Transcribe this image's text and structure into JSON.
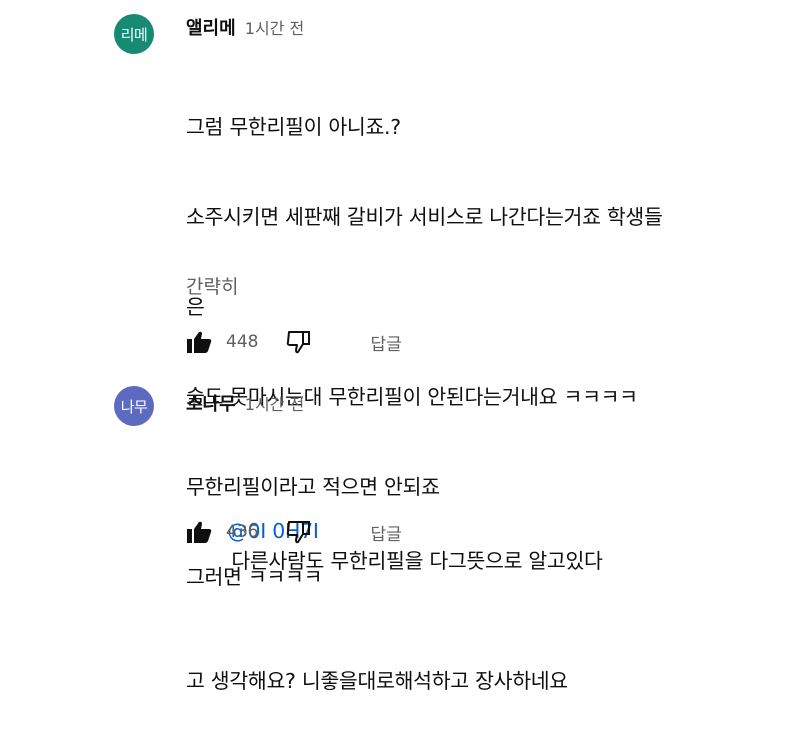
{
  "colors": {
    "avatar1": "#168a73",
    "avatar2": "#5c6bc0",
    "link": "#065fd4",
    "muted": "#606060"
  },
  "comments": [
    {
      "avatar_text": "리메",
      "author": "앨리메",
      "time": "1시간 전",
      "lines": [
        "그럼 무한리필이 아니죠.?",
        "소주시키면 세판째 갈비가 서비스로 나간다는거죠 학생들",
        "은",
        "술도 못마시는대 무한리필이 안된다는거내요 ㅋㅋㅋㅋ",
        "무한리필이라고 적으면 안되죠",
        "그러면 ㅋㅋㅋㅋ"
      ],
      "toggle": "간략히",
      "likes": "448",
      "reply": "답글"
    },
    {
      "avatar_text": "나무",
      "author": "소나무",
      "time": "1시간 전",
      "mention": "@0I 0H7I",
      "line1_rest": "다른사람도 무한리필을 다그뜻으로 알고있다",
      "line2": "고 생각해요? 니좋을대로해석하고 장사하네요",
      "likes": "436",
      "reply": "답글"
    }
  ]
}
